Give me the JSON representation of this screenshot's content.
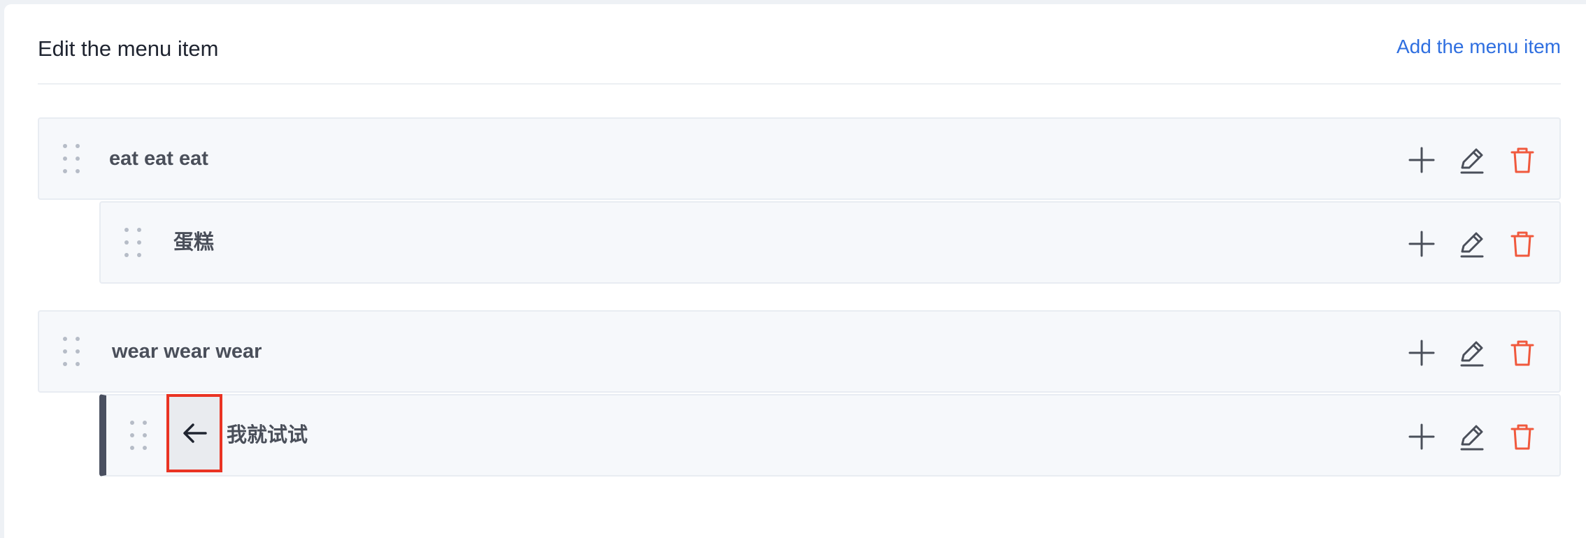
{
  "header": {
    "title": "Edit the menu item",
    "add_link": "Add the menu item"
  },
  "menu_items": [
    {
      "label": "eat eat eat",
      "level": 0
    },
    {
      "label": "蛋糕",
      "level": 1
    },
    {
      "label": "wear wear wear",
      "level": 0
    },
    {
      "label": "我就试试",
      "level": 1,
      "active": true
    }
  ],
  "icons": {
    "drag": "drag-handle-icon",
    "add": "plus-icon",
    "edit": "pencil-icon",
    "delete": "trash-icon",
    "outdent": "arrow-left-icon"
  },
  "colors": {
    "link": "#2f6fe0",
    "delete": "#f0593d",
    "icon": "#4a4f5a",
    "highlight": "#ea3323",
    "active_bar": "#4a5060"
  }
}
